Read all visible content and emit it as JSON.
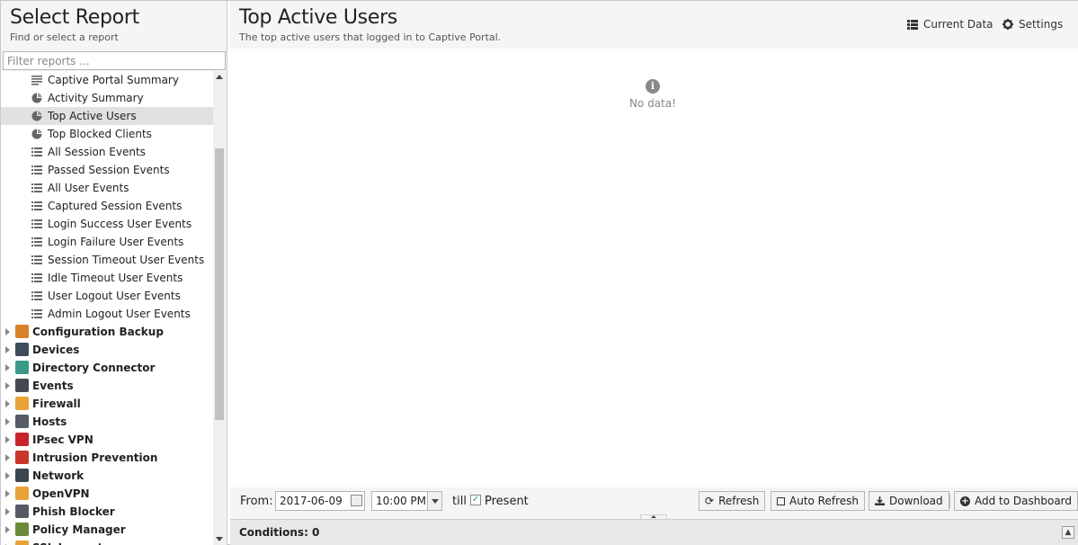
{
  "left_panel": {
    "title": "Select Report",
    "subtitle": "Find or select a report",
    "filter_placeholder": "Filter reports ..."
  },
  "tree": {
    "children": [
      {
        "label": "Captive Portal Summary",
        "icon": "text-lines-icon",
        "selected": false
      },
      {
        "label": "Activity Summary",
        "icon": "pie-chart-icon",
        "selected": false
      },
      {
        "label": "Top Active Users",
        "icon": "pie-chart-icon",
        "selected": true
      },
      {
        "label": "Top Blocked Clients",
        "icon": "pie-chart-icon",
        "selected": false
      },
      {
        "label": "All Session Events",
        "icon": "list-icon",
        "selected": false
      },
      {
        "label": "Passed Session Events",
        "icon": "list-icon",
        "selected": false
      },
      {
        "label": "All User Events",
        "icon": "list-icon",
        "selected": false
      },
      {
        "label": "Captured Session Events",
        "icon": "list-icon",
        "selected": false
      },
      {
        "label": "Login Success User Events",
        "icon": "list-icon",
        "selected": false
      },
      {
        "label": "Login Failure User Events",
        "icon": "list-icon",
        "selected": false
      },
      {
        "label": "Session Timeout User Events",
        "icon": "list-icon",
        "selected": false
      },
      {
        "label": "Idle Timeout User Events",
        "icon": "list-icon",
        "selected": false
      },
      {
        "label": "User Logout User Events",
        "icon": "list-icon",
        "selected": false
      },
      {
        "label": "Admin Logout User Events",
        "icon": "list-icon",
        "selected": false
      }
    ],
    "categories": [
      {
        "label": "Configuration Backup",
        "icon": "backup-icon",
        "color": "#d9822b"
      },
      {
        "label": "Devices",
        "icon": "devices-icon",
        "color": "#3d4d5c"
      },
      {
        "label": "Directory Connector",
        "icon": "directory-connector-icon",
        "color": "#3a9a8a"
      },
      {
        "label": "Events",
        "icon": "events-icon",
        "color": "#444a52"
      },
      {
        "label": "Firewall",
        "icon": "firewall-icon",
        "color": "#e8a33a"
      },
      {
        "label": "Hosts",
        "icon": "hosts-icon",
        "color": "#555c66"
      },
      {
        "label": "IPsec VPN",
        "icon": "ipsec-lock-icon",
        "color": "#c8252a"
      },
      {
        "label": "Intrusion Prevention",
        "icon": "intrusion-prevention-icon",
        "color": "#c8352a"
      },
      {
        "label": "Network",
        "icon": "network-icon",
        "color": "#3d4650"
      },
      {
        "label": "OpenVPN",
        "icon": "openvpn-icon",
        "color": "#e8a33a"
      },
      {
        "label": "Phish Blocker",
        "icon": "phish-blocker-icon",
        "color": "#555c66"
      },
      {
        "label": "Policy Manager",
        "icon": "policy-manager-icon",
        "color": "#6a8a3a"
      },
      {
        "label": "SSL Inspector",
        "icon": "ssl-inspector-icon",
        "color": "#e8a33a"
      }
    ]
  },
  "report": {
    "title": "Top Active Users",
    "description": "The top active users that logged in to Captive Portal.",
    "current_data_label": "Current Data",
    "settings_label": "Settings",
    "no_data_text": "No data!"
  },
  "toolbar": {
    "from_label": "From:",
    "date_value": "2017-06-09",
    "time_value": "10:00 PM",
    "till_label": "till",
    "present_label": "Present",
    "present_checked": true,
    "refresh_label": "Refresh",
    "auto_refresh_label": "Auto Refresh",
    "download_label": "Download",
    "add_dashboard_label": "Add to Dashboard"
  },
  "conditions": {
    "label": "Conditions: 0"
  }
}
